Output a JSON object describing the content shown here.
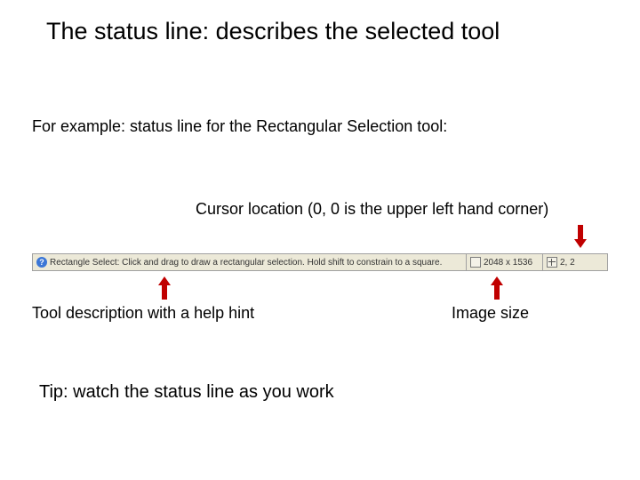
{
  "title": "The status line: describes the selected tool",
  "example_intro": "For example:  status line for the Rectangular Selection tool:",
  "cursor_label": "Cursor location (0, 0 is the upper left hand corner)",
  "statusbar": {
    "help_glyph": "?",
    "description": "Rectangle Select: Click and drag to draw a rectangular selection. Hold shift to constrain to a square.",
    "image_size": "2048 x 1536",
    "cursor_position": "2, 2"
  },
  "tool_desc_label": "Tool description with a help hint",
  "image_size_label": "Image size",
  "tip": "Tip:  watch the status line as you work"
}
